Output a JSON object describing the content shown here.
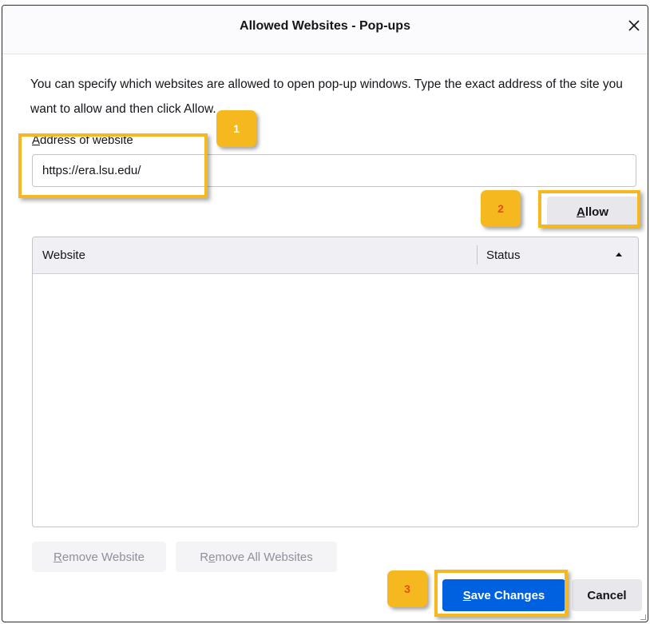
{
  "dialog": {
    "title": "Allowed Websites - Pop-ups",
    "description": "You can specify which websites are allowed to open pop-up windows. Type the exact address of the site you want to allow and then click Allow.",
    "address_label_accesskey": "A",
    "address_label_rest": "ddress of website",
    "address_value": "https://era.lsu.edu/",
    "allow_button": {
      "accesskey": "A",
      "rest": "llow"
    },
    "table": {
      "columns": [
        "Website",
        "Status"
      ],
      "sort_direction": "ascending",
      "rows": []
    },
    "remove_button": {
      "accesskey": "R",
      "rest": "emove Website"
    },
    "remove_all_button": {
      "pre": "R",
      "accesskey": "e",
      "rest": "move All Websites"
    },
    "save_button": {
      "accesskey": "S",
      "rest": "ave Changes"
    },
    "cancel_label": "Cancel"
  },
  "annotations": {
    "step1": "1",
    "step2": "2",
    "step3": "3",
    "highlight_color": "#f5b81f"
  },
  "colors": {
    "primary_button": "#0061e0",
    "secondary_button": "#e8e8ec"
  },
  "icons": {
    "close": "close-icon",
    "sort": "sort-ascending-icon"
  }
}
